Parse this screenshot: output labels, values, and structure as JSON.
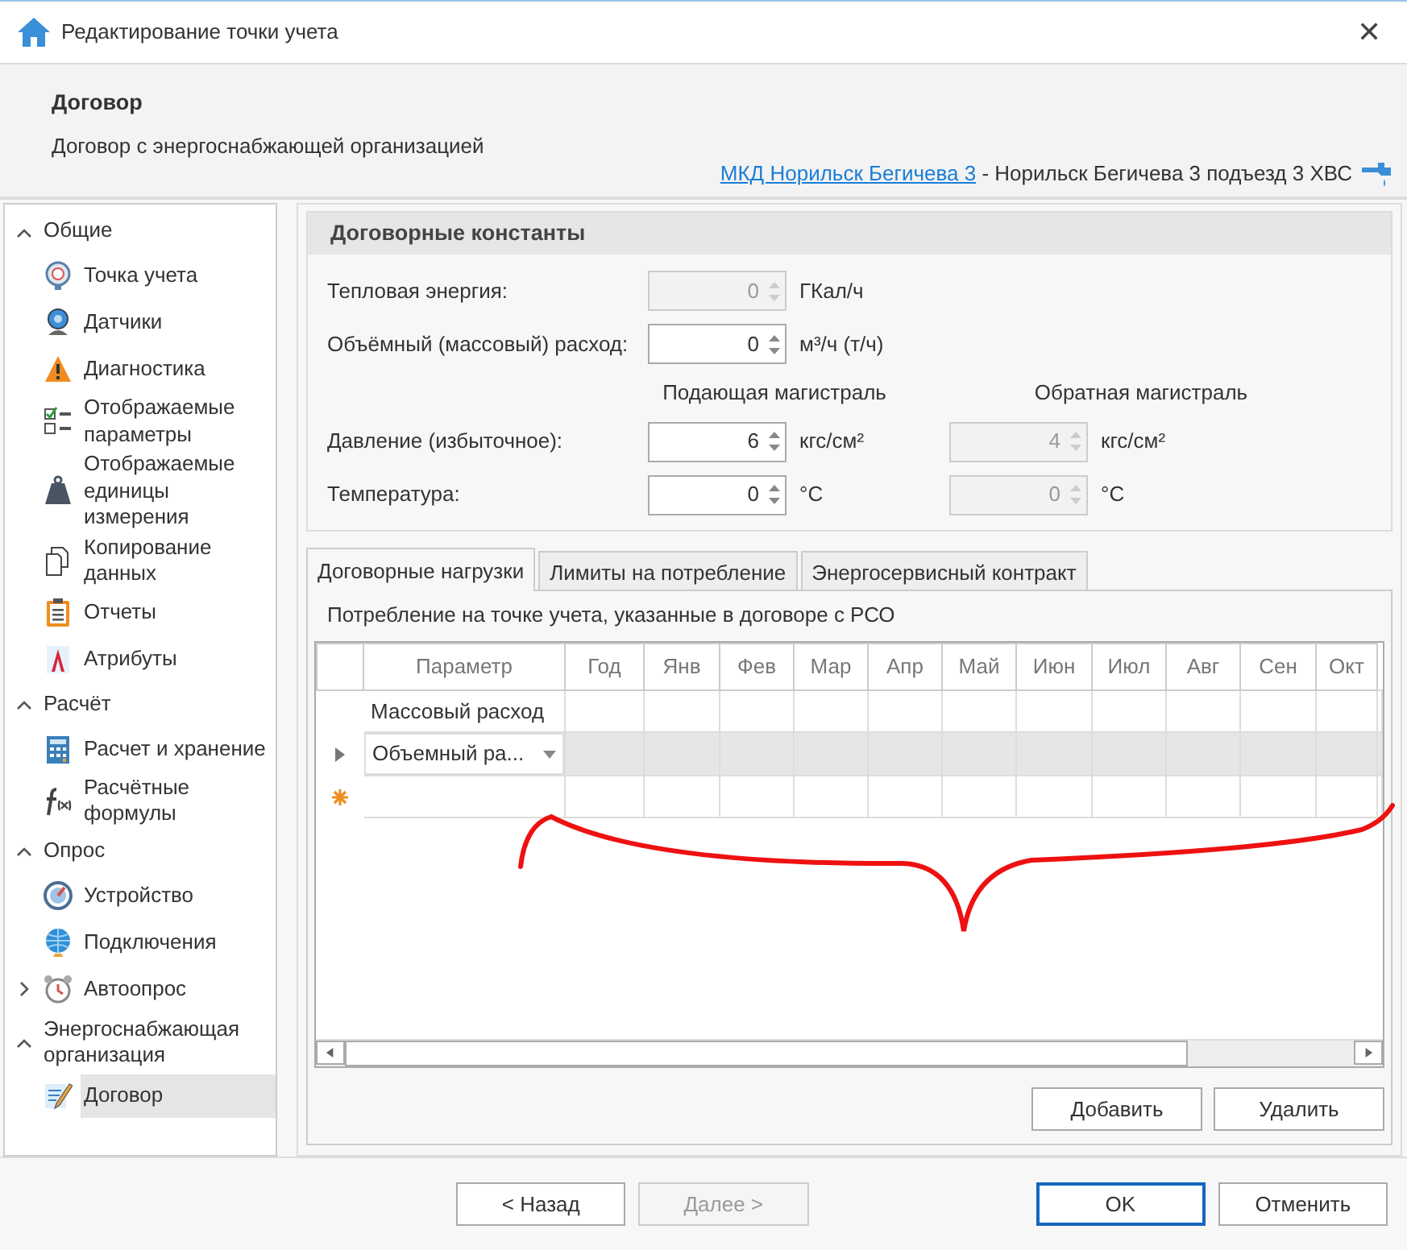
{
  "window": {
    "title": "Редактирование точки учета",
    "close": "✕"
  },
  "header": {
    "title": "Договор",
    "subtitle": "Договор с энергоснабжающей организацией",
    "link": "МКД Норильск Бегичева 3",
    "path": " - Норильск Бегичева 3 подъезд 3 ХВС"
  },
  "sidebar": {
    "groups": [
      {
        "label": "Общие",
        "expanded": true,
        "items": [
          {
            "label": "Точка учета",
            "selected": false
          },
          {
            "label": "Датчики",
            "selected": false
          },
          {
            "label": "Диагностика",
            "selected": false
          },
          {
            "label": "Отображаемые параметры",
            "selected": false
          },
          {
            "label": "Отображаемые единицы измерения",
            "selected": false
          },
          {
            "label": "Копирование данных",
            "selected": false
          },
          {
            "label": "Отчеты",
            "selected": false
          },
          {
            "label": "Атрибуты",
            "selected": false
          }
        ]
      },
      {
        "label": "Расчёт",
        "expanded": true,
        "items": [
          {
            "label": "Расчет и хранение",
            "selected": false
          },
          {
            "label": "Расчётные формулы",
            "selected": false
          }
        ]
      },
      {
        "label": "Опрос",
        "expanded": true,
        "items": [
          {
            "label": "Устройство",
            "selected": false
          },
          {
            "label": "Подключения",
            "selected": false
          },
          {
            "label": "Автоопрос",
            "selected": false,
            "expanded": false
          }
        ]
      },
      {
        "label": "Энергоснабжающая организация",
        "expanded": true,
        "items": [
          {
            "label": "Договор",
            "selected": true
          }
        ]
      }
    ]
  },
  "constants": {
    "title": "Договорные константы",
    "rows": [
      {
        "label": "Тепловая энергия:",
        "fields": [
          {
            "value": "0",
            "unit": "ГКал/ч",
            "disabled": true
          }
        ]
      },
      {
        "label": "Объёмный (массовый) расход:",
        "fields": [
          {
            "value": "0",
            "unit": "м³/ч (т/ч)",
            "disabled": false
          }
        ]
      }
    ],
    "column_headers": [
      "Подающая магистраль",
      "Обратная магистраль"
    ],
    "pipe_rows": [
      {
        "label": "Давление (избыточное):",
        "fields": [
          {
            "value": "6",
            "unit": "кгс/см²",
            "disabled": false
          },
          {
            "value": "4",
            "unit": "кгс/см²",
            "disabled": true
          }
        ]
      },
      {
        "label": "Температура:",
        "fields": [
          {
            "value": "0",
            "unit": "°C",
            "disabled": false
          },
          {
            "value": "0",
            "unit": "°C",
            "disabled": true
          }
        ]
      }
    ]
  },
  "tabs": [
    {
      "label": "Договорные нагрузки",
      "selected": true
    },
    {
      "label": "Лимиты на потребление",
      "selected": false
    },
    {
      "label": "Энергосервисный контракт",
      "selected": false
    }
  ],
  "loads": {
    "caption": "Потребление на точке учета, указанные в договоре с РСО",
    "columns": [
      "Параметр",
      "Год",
      "Янв",
      "Фев",
      "Мар",
      "Апр",
      "Май",
      "Июн",
      "Июл",
      "Авг",
      "Сен",
      "Окт"
    ],
    "rows": [
      {
        "kind": "data",
        "parameter": "Массовый расход",
        "selected": false,
        "dropdown": false
      },
      {
        "kind": "data",
        "parameter": "Объемный ра...",
        "selected": true,
        "dropdown": true
      },
      {
        "kind": "new",
        "parameter": "",
        "selected": false,
        "dropdown": false
      }
    ]
  },
  "grid_buttons": [
    "Добавить",
    "Удалить"
  ],
  "footer": [
    {
      "label": "< Назад",
      "disabled": false,
      "default": false
    },
    {
      "label": "Далее >",
      "disabled": true,
      "default": false
    },
    {
      "label": "OK",
      "disabled": false,
      "default": true
    },
    {
      "label": "Отменить",
      "disabled": false,
      "default": false
    }
  ]
}
